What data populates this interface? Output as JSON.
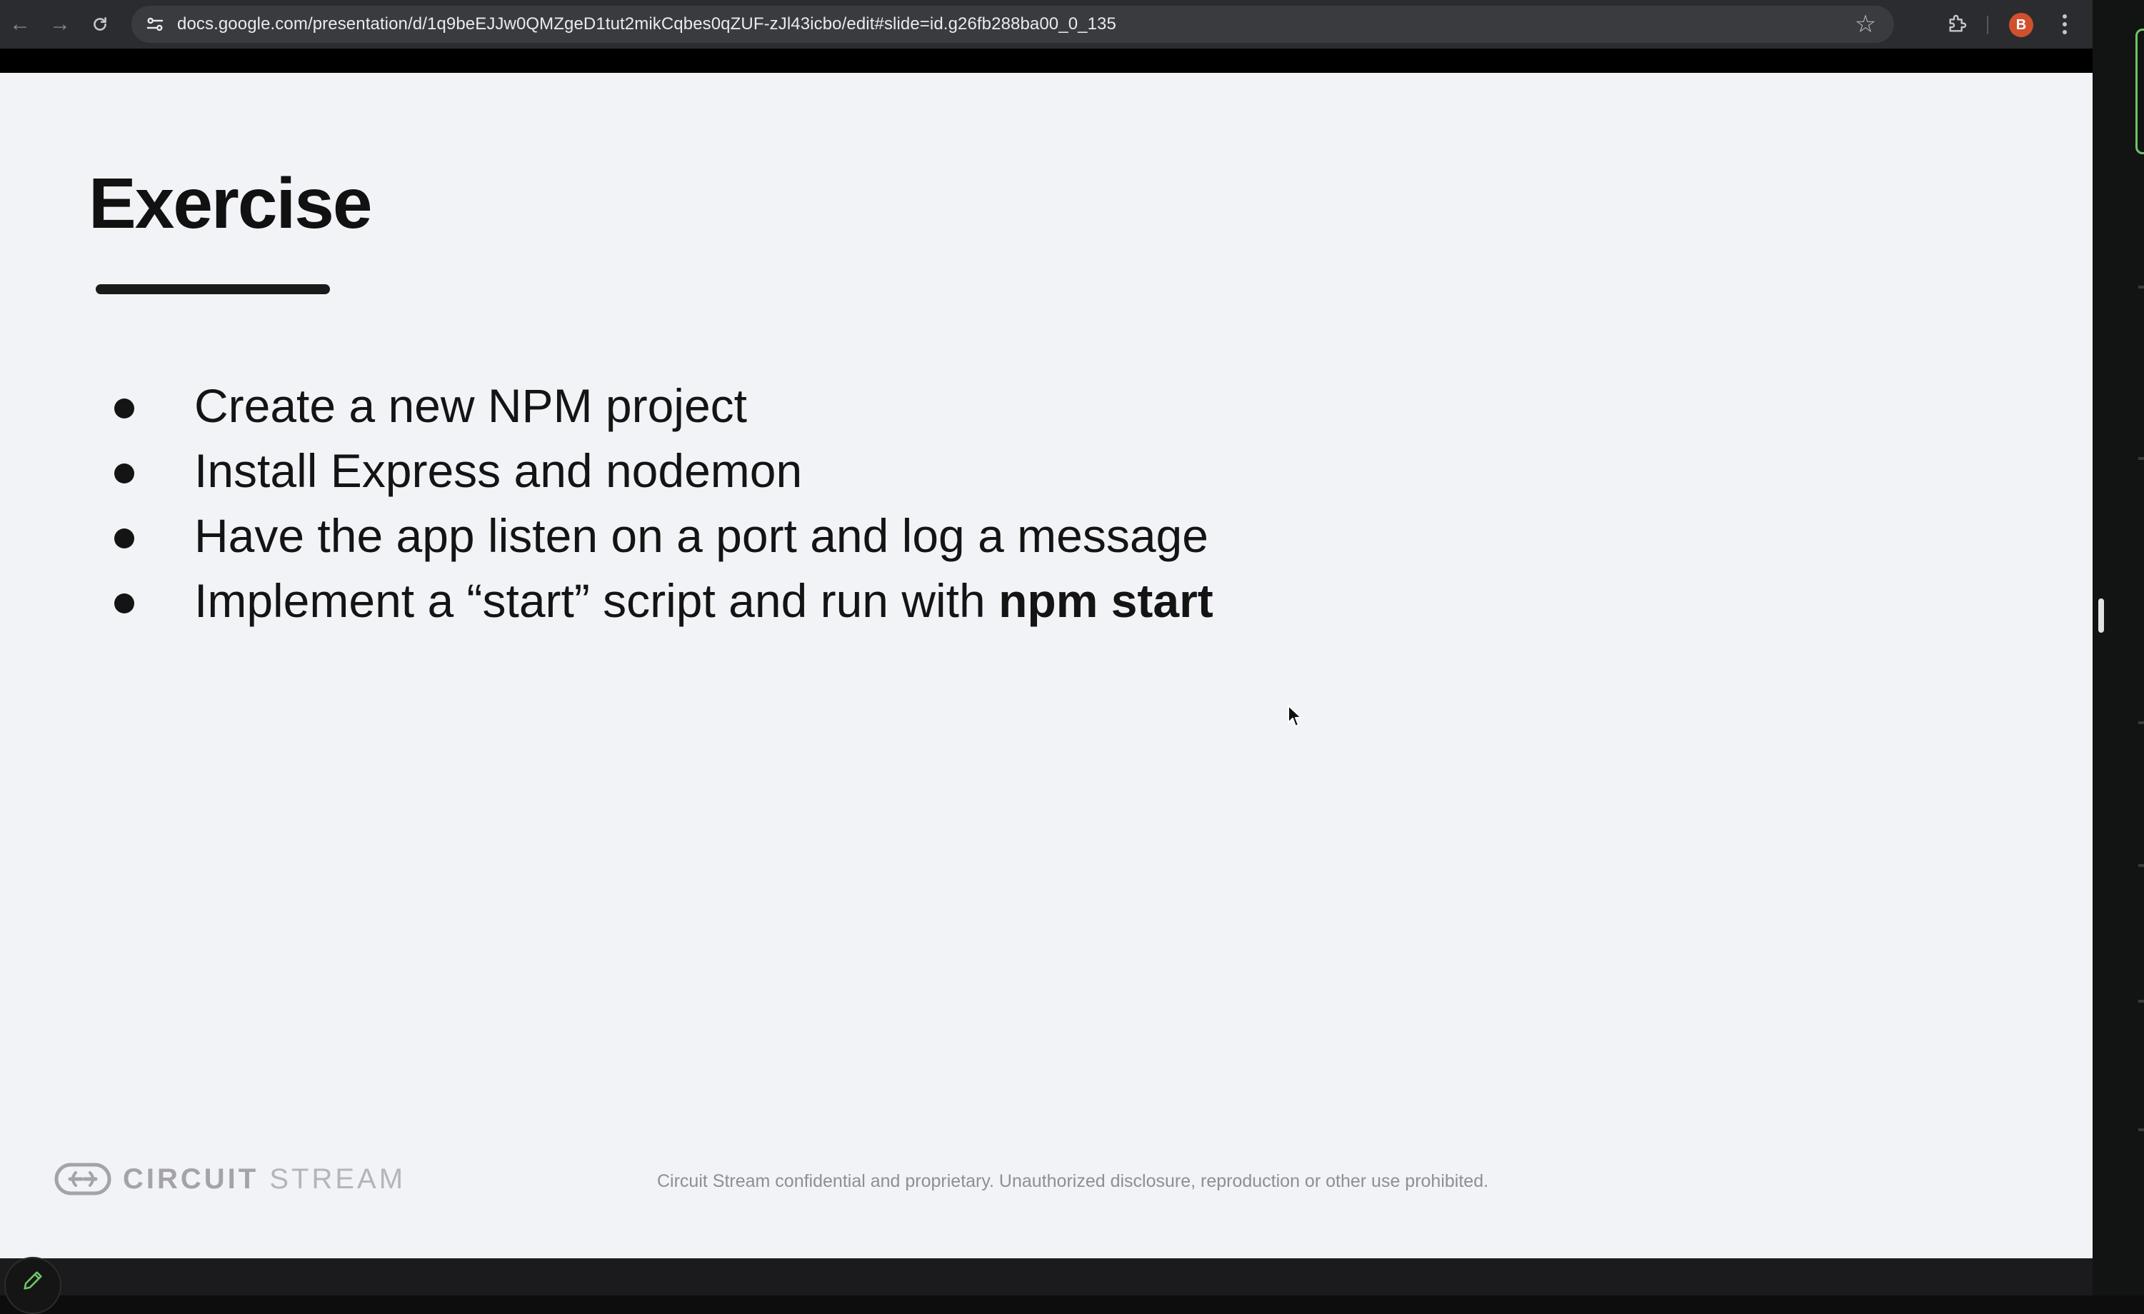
{
  "browser": {
    "url": "docs.google.com/presentation/d/1q9beEJJw0QMZgeD1tut2mikCqbes0qZUF-zJl43icbo/edit#slide=id.g26fb288ba00_0_135",
    "profile_initial": "B",
    "profile_color": "#d0502e",
    "icons": [
      "back-icon",
      "forward-icon",
      "reload-icon",
      "site-info-icon",
      "star-icon",
      "extensions-icon",
      "menu-icon"
    ]
  },
  "slide": {
    "title": "Exercise",
    "bullets": [
      {
        "text": "Create a new NPM project",
        "bold": ""
      },
      {
        "text": "Install Express and nodemon",
        "bold": ""
      },
      {
        "text": "Have the app listen on a port and log a message",
        "bold": ""
      },
      {
        "text": "Implement a “start” script and run with ",
        "bold": "npm start"
      }
    ],
    "brand": {
      "word1": "CIRCUIT",
      "word2": "STREAM"
    },
    "footer": "Circuit Stream confidential and proprietary. Unauthorized disclosure, reproduction or other use prohibited."
  }
}
